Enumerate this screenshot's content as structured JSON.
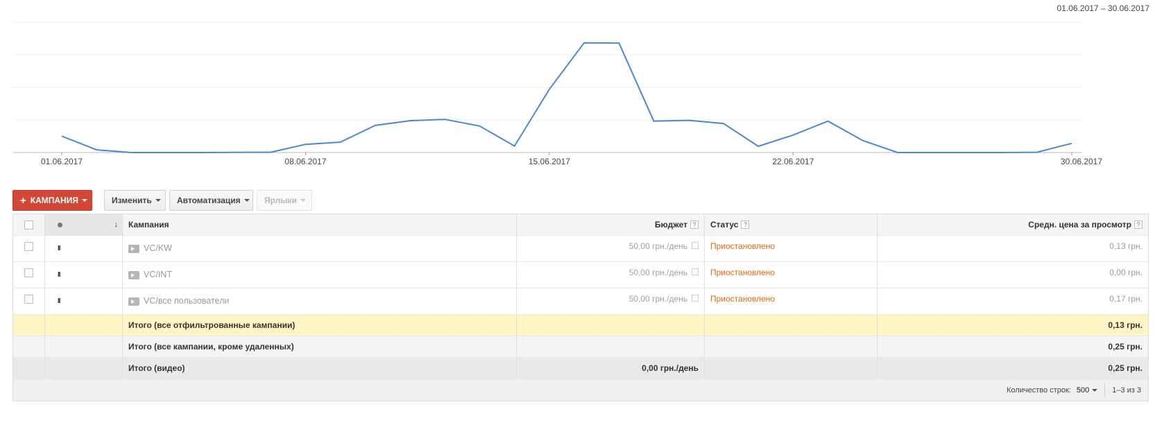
{
  "date_range": "01.06.2017 – 30.06.2017",
  "chart_data": {
    "type": "line",
    "x": [
      "01.06.2017",
      "02.06.2017",
      "03.06.2017",
      "04.06.2017",
      "05.06.2017",
      "06.06.2017",
      "07.06.2017",
      "08.06.2017",
      "09.06.2017",
      "10.06.2017",
      "11.06.2017",
      "12.06.2017",
      "13.06.2017",
      "14.06.2017",
      "15.06.2017",
      "16.06.2017",
      "17.06.2017",
      "18.06.2017",
      "19.06.2017",
      "20.06.2017",
      "21.06.2017",
      "22.06.2017",
      "23.06.2017",
      "24.06.2017",
      "25.06.2017",
      "26.06.2017",
      "27.06.2017",
      "28.06.2017",
      "29.06.2017",
      "30.06.2017"
    ],
    "values": [
      0.126,
      0.021,
      0.0,
      0.0,
      0.0,
      0.001,
      0.002,
      0.063,
      0.08,
      0.208,
      0.244,
      0.254,
      0.203,
      0.05,
      0.485,
      0.842,
      0.84,
      0.241,
      0.247,
      0.223,
      0.048,
      0.134,
      0.241,
      0.092,
      0.0,
      0.0,
      0.0,
      0.0,
      0.002,
      0.07
    ],
    "ylim": [
      0,
      1
    ],
    "line_color": "#4a86d4",
    "grid": true,
    "tick_labels": [
      "01.06.2017",
      "08.06.2017",
      "15.06.2017",
      "22.06.2017",
      "30.06.2017"
    ],
    "tick_indices": [
      0,
      7,
      14,
      21,
      29
    ]
  },
  "toolbar": {
    "campaign_label": "КАМПАНИЯ",
    "edit_label": "Изменить",
    "automation_label": "Автоматизация",
    "labels_label": "Ярлыки"
  },
  "table": {
    "headers": {
      "campaign": "Кампания",
      "budget": "Бюджет",
      "status": "Статус",
      "avg_price": "Средн. цена за просмотр",
      "help": "?"
    },
    "rows": [
      {
        "name": "VC/KW",
        "budget": "50,00 грн./день",
        "status": "Приостановлено",
        "price": "0,13 грн."
      },
      {
        "name": "VC/INT",
        "budget": "50,00 грн./день",
        "status": "Приостановлено",
        "price": "0,00 грн."
      },
      {
        "name": "VC/все пользователи",
        "budget": "50,00 грн./день",
        "status": "Приостановлено",
        "price": "0,17 грн."
      }
    ],
    "totals": [
      {
        "label": "Итого (все отфильтрованные кампании)",
        "budget": "",
        "price": "0,13 грн."
      },
      {
        "label": "Итого (все кампании, кроме удаленных)",
        "budget": "",
        "price": "0,25 грн."
      },
      {
        "label": "Итого (видео)",
        "budget": "0,00 грн./день",
        "price": "0,25 грн."
      }
    ],
    "pause_glyph": "II"
  },
  "footer": {
    "rows_label": "Количество строк:",
    "rows_value": "500",
    "range": "1–3 из 3"
  }
}
